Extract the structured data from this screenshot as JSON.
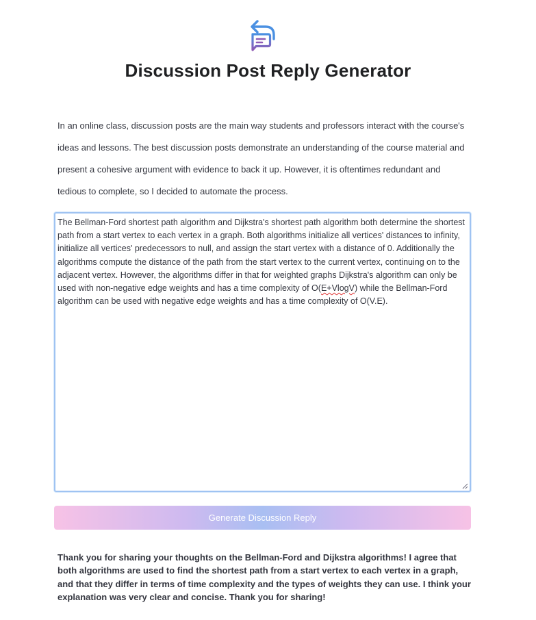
{
  "app": {
    "title": "Discussion Post Reply Generator",
    "logo_icon": "chat-reply-icon"
  },
  "intro": {
    "text": "In an online class, discussion posts are the main way students and professors interact with the course's ideas and lessons. The best discussion posts demonstrate an understanding of the course material and present a cohesive argument with evidence to back it up. However, it is oftentimes redundant and tedious to complete, so I decided to automate the process."
  },
  "input": {
    "text_before": "The Bellman-Ford shortest path algorithm and Dijkstra's shortest path algorithm both determine the shortest path from a start vertex to each vertex in a graph. Both algorithms initialize all vertices' distances to infinity, initialize all vertices' predecessors to null, and assign the start vertex with a distance of 0. Additionally the algorithms compute the distance of the path from the start vertex to the current vertex, continuing on to the adjacent vertex. However, the algorithms differ in that for weighted graphs Dijkstra's algorithm can only be used with non-negative edge weights and has a time complexity of O(",
    "text_misspelled": "E+VlogV",
    "text_after": ") while the Bellman-Ford algorithm can be used with negative edge weights and has a time complexity of O(V.E)."
  },
  "generate_button": {
    "label": "Generate Discussion Reply"
  },
  "output": {
    "reply": "Thank you for sharing your thoughts on the Bellman-Ford and Dijkstra algorithms! I agree that both algorithms are used to find the shortest path from a start vertex to each vertex in a graph, and that they differ in terms of time complexity and the types of weights they can use. I think your explanation was very clear and concise. Thank you for sharing!"
  },
  "colors": {
    "logo_blue": "#4a90e2",
    "logo_purple": "#8e5bb5",
    "textarea_border": "#9fc3f2",
    "button_pink": "#f7c2e6",
    "button_blue": "#a9bff2"
  }
}
